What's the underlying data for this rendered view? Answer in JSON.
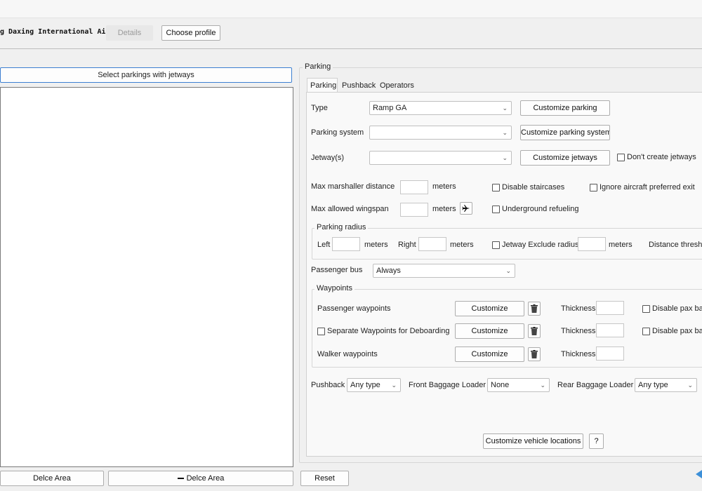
{
  "header": {
    "airport_name": "g Daxing International Ai",
    "details_label": "Details",
    "choose_profile_label": "Choose profile"
  },
  "left": {
    "select_jetways_label": "Select parkings with jetways",
    "delete_area_1": "Delce Area",
    "delete_area_2": "Delce Area",
    "reset_label": "Reset"
  },
  "parking": {
    "group_title": "Parking",
    "tabs": [
      "Parking",
      "Pushback",
      "Operators"
    ],
    "active_tab": "Parking",
    "type": {
      "label": "Type",
      "value": "Ramp GA",
      "button": "Customize parking"
    },
    "system": {
      "label": "Parking system",
      "value": "",
      "button": "Customize parking system"
    },
    "jetways": {
      "label": "Jetway(s)",
      "value": "",
      "button": "Customize jetways",
      "checkbox": "Don't create jetways"
    },
    "marshaller": {
      "label": "Max marshaller distance",
      "unit": "meters",
      "value": ""
    },
    "wingspan": {
      "label": "Max allowed wingspan",
      "unit": "meters",
      "value": ""
    },
    "disable_staircases": "Disable staircases",
    "ignore_exit": "Ignore aircraft preferred exit",
    "underground_refueling": "Underground refueling",
    "radius": {
      "title": "Parking radius",
      "left_label": "Left",
      "left_unit": "meters",
      "right_label": "Right",
      "right_unit": "meters",
      "jetway_exclude": "Jetway Exclude radius",
      "exclude_unit": "meters",
      "distance_threshold": "Distance thresho"
    },
    "passenger_bus": {
      "label": "Passenger bus",
      "value": "Always"
    },
    "waypoints": {
      "title": "Waypoints",
      "rows": [
        {
          "label": "Passenger waypoints",
          "button": "Customize",
          "thickness": "Thickness",
          "disable": "Disable pax bar"
        },
        {
          "label": "Separate Waypoints for Deboarding",
          "button": "Customize",
          "thickness": "Thickness",
          "disable": "Disable pax bar"
        },
        {
          "label": "Walker waypoints",
          "button": "Customize",
          "thickness": "Thickness"
        }
      ]
    },
    "pushback": {
      "label": "Pushback",
      "value": "Any type"
    },
    "front_loader": {
      "label": "Front Baggage Loader",
      "value": "None"
    },
    "rear_loader": {
      "label": "Rear Baggage Loader",
      "value": "Any type"
    },
    "vehicle_locations_label": "Customize vehicle locations",
    "help_label": "?"
  },
  "icons": {
    "airplane": "airplane-icon",
    "trash": "trash-icon",
    "minus": "minus-icon",
    "dropdown": "chevron-down-icon"
  },
  "colors": {
    "focus_border": "#3c7fd1",
    "window_bg": "#f0f0f0"
  }
}
